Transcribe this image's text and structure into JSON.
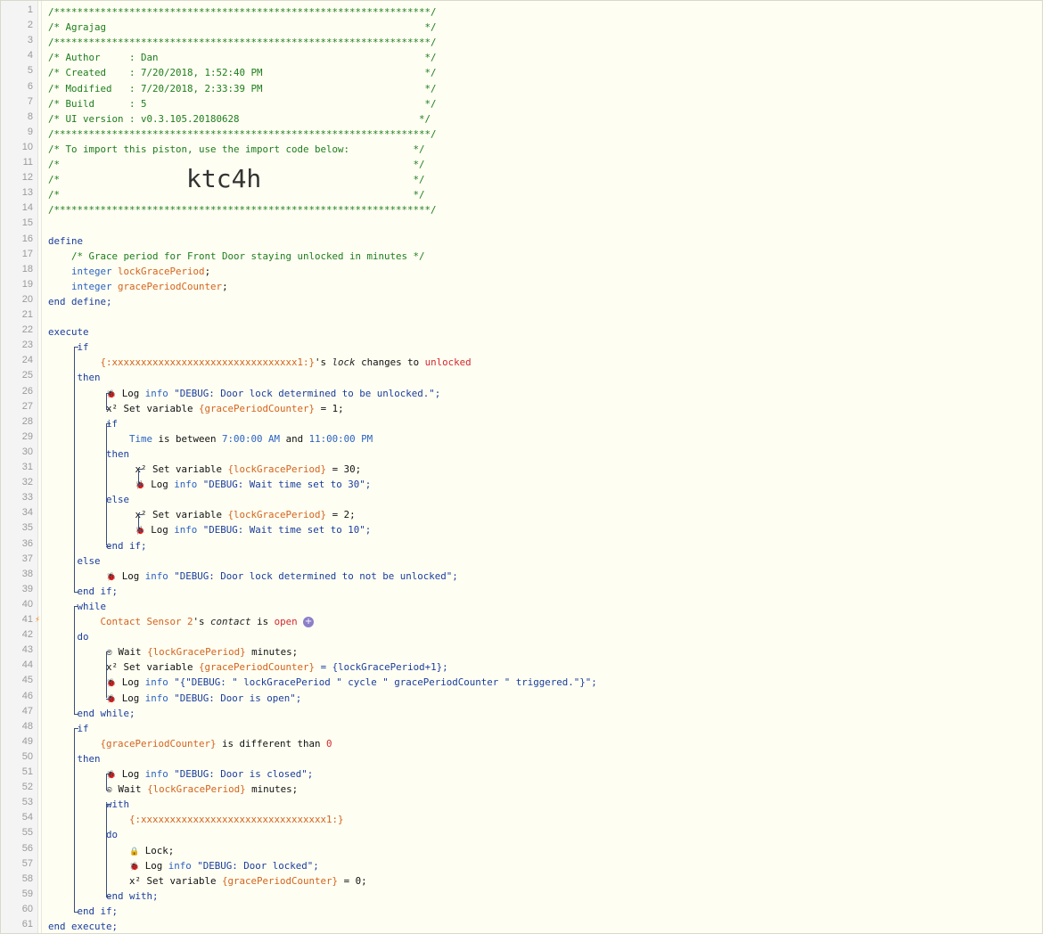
{
  "header": {
    "border": "/*****************************************************************/",
    "title_line": "/* Agrajag                                                       */",
    "author_line": "/* Author     : Dan                                              */",
    "created_line": "/* Created    : 7/20/2018, 1:52:40 PM                            */",
    "modified_line": "/* Modified   : 7/20/2018, 2:33:39 PM                            */",
    "build_line": "/* Build      : 5                                                */",
    "ui_line": "/* UI version : v0.3.105.20180628                               */",
    "import_line": "/* To import this piston, use the import code below:           */",
    "blank_line": "/*                                                             */",
    "import_code": "ktc4h"
  },
  "colors": {
    "comment": "#1d7d1d",
    "keyword": "#1a3d9e",
    "variable": "#d4631c",
    "value": "#d4272d",
    "accent_plus": "#8d7ec8",
    "bolt": "#f08a24"
  },
  "code": {
    "define": "define",
    "grace_comment": "/* Grace period for Front Door staying unlocked in minutes */",
    "integer": "integer",
    "var_lock": "lockGracePeriod",
    "var_counter": "gracePeriodCounter",
    "semicolon": ";",
    "end_define": "end define;",
    "execute": "execute",
    "if": "if",
    "then": "then",
    "else": "else",
    "end_if": "end if;",
    "while": "while",
    "do": "do",
    "end_while": "end while;",
    "with": "with",
    "end_with": "end with;",
    "end_execute": "end execute;",
    "device_x": "{:xxxxxxxxxxxxxxxxxxxxxxxxxxxxxxxx1:}",
    "s_suffix": "'s ",
    "lock_attr": "lock",
    "changes_to": " changes to ",
    "unlocked": "unlocked",
    "log": " Log ",
    "info": "info",
    "msg_unlocked": " \"DEBUG: Door lock determined to be unlocked.\";",
    "set_variable": " Set variable ",
    "brace_counter": "{gracePeriodCounter}",
    "brace_lock": "{lockGracePeriod}",
    "eq_1": " = 1;",
    "time": "Time",
    "is_between": " is between ",
    "time_start": "7:00:00 AM",
    "and": " and ",
    "time_end": "11:00:00 PM",
    "eq_30": " = 30;",
    "msg_wait_30": " \"DEBUG: Wait time set to 30\";",
    "eq_2": " = 2;",
    "msg_wait_10": " \"DEBUG: Wait time set to 10\";",
    "msg_not_unlocked": " \"DEBUG: Door lock determined to not be unlocked\";",
    "contact_sensor": "Contact Sensor 2",
    "contact_attr": "contact",
    "is": " is ",
    "open": "open",
    "wait": " Wait ",
    "minutes": " minutes;",
    "eq_lock_plus1": " = {lockGracePeriod+1};",
    "msg_cycle": " \"{\"DEBUG: \" lockGracePeriod \" cycle \" gracePeriodCounter \" triggered.\"}\";",
    "msg_door_open": " \"DEBUG: Door is open\";",
    "is_different_than": " is different than ",
    "zero": "0",
    "msg_closed": " \"DEBUG: Door is closed\";",
    "lock_cmd": " Lock;",
    "msg_locked": " \"DEBUG: Door locked\";",
    "eq_0": " = 0;",
    "x2": "x²",
    "plus": "+"
  },
  "icons": {
    "bug": "bug-icon",
    "clock": "clock-icon",
    "lock": "lock-icon",
    "bolt": "bolt-icon",
    "plus": "plus-icon"
  },
  "line_count": 61
}
